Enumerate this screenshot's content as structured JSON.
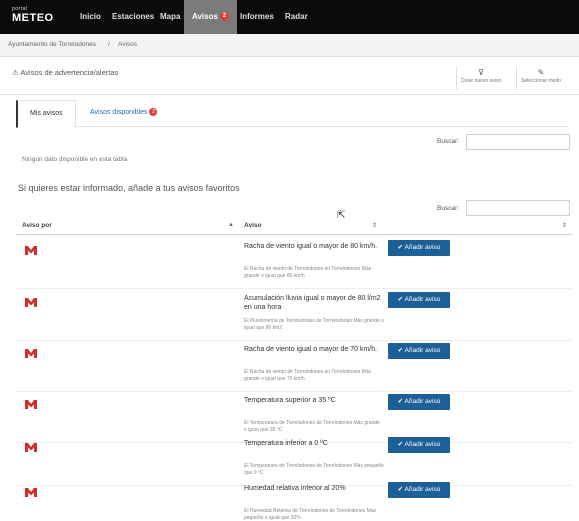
{
  "logo": {
    "top": "portal",
    "main": "METEO"
  },
  "nav": {
    "items": [
      "Inicio",
      "Estaciones",
      "Mapa",
      "Avisos",
      "Informes",
      "Radar"
    ],
    "active_badge": "2"
  },
  "breadcrumb": {
    "parent": "Ayuntamiento de Torrelodones",
    "current": "Avisos"
  },
  "section": {
    "title": "Avisos de advertencia/alertas",
    "buttons": [
      {
        "label": "Crear nuevo aviso",
        "icon": "filter-icon"
      },
      {
        "label": "Seleccionar modo",
        "icon": "pencil-icon"
      }
    ]
  },
  "tabs": {
    "mine": "Mis avisos",
    "available": "Avisos disponibles",
    "available_badge": "2"
  },
  "search": {
    "label": "Buscar:"
  },
  "empty_message": "Ningún dato disponible en esta tabla",
  "subheading": "Si quieres estar informado, añade a tus avisos favoritos",
  "table": {
    "col_source": "Aviso por",
    "col_alert": "Aviso",
    "rows": [
      {
        "title": "Racha de viento igual o mayor de 80 km/h.",
        "desc": "El Racha de viento de Torrelodones en Torrelodones Más grande o igual que 80 km/h",
        "button": "✔ Añadir aviso"
      },
      {
        "title": "Acumulación lluvia igual o mayor de 80 l/m2 en una hora",
        "desc": "El Pluviometría de Torrelodones de Torrelodones Más grande o igual que 80 l/m2",
        "button": "✔ Añadir aviso"
      },
      {
        "title": "Racha de viento igual o mayor de 70 km/h.",
        "desc": "El Racha de viento de Torrelodones en Torrelodones Más grande o igual que 70 km/h",
        "button": "✔ Añadir aviso"
      },
      {
        "title": "Temperatura superior a 35 ºC",
        "desc": "El Temperatura de Torrelodones de Torrelodones Más grande o igual que 35 ºC",
        "button": "✔ Añadir aviso"
      },
      {
        "title": "Temperatura inferior a 0 ºC",
        "desc": "El Temperatura de Torrelodones de Torrelodones Más pequeño que 0 ºC",
        "button": "✔ Añadir aviso"
      },
      {
        "title": "Humedad relativa inferior al 20%",
        "desc": "El Humedad Relativa de Torrelodones de Torrelodones Más pequeño o igual que 20%",
        "button": "✔ Añadir aviso"
      }
    ]
  },
  "colors": {
    "topbar": "#0b0b0b",
    "button": "#1d5f97",
    "badge": "#e23d3d",
    "logo_m": "#d22e2e"
  }
}
